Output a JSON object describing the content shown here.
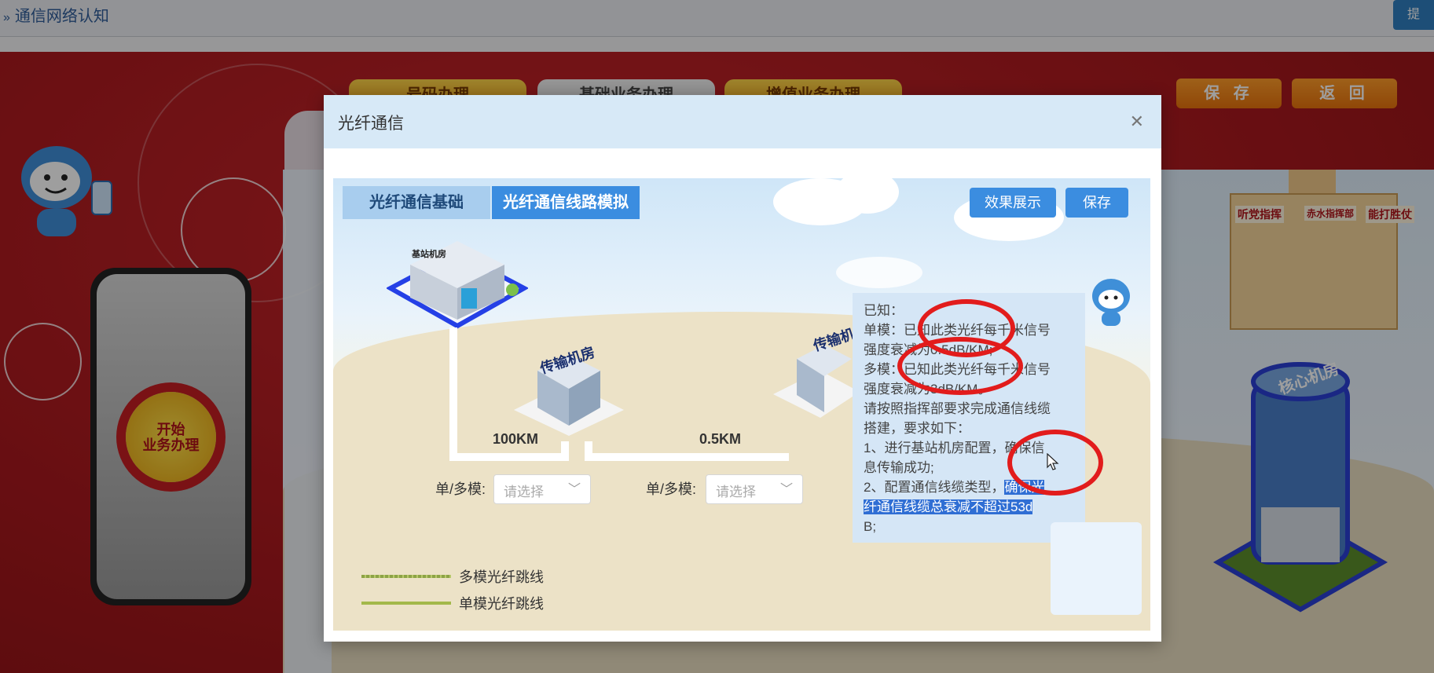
{
  "topbar": {
    "breadcrumb_arrow": "»",
    "breadcrumb": "通信网络认知",
    "right_button": "提"
  },
  "background": {
    "tabs": [
      "号码办理",
      "基础业务办理",
      "增值业务办理"
    ],
    "save_label": "保 存",
    "back_label": "返 回",
    "start_button": "开始\n业务办理",
    "hq_signs": [
      "听党指挥",
      "赤水指挥部",
      "能打胜仗"
    ],
    "tower_label": "核心机房"
  },
  "modal": {
    "title": "光纤通信",
    "close_icon": "close-icon",
    "tabs": [
      {
        "label": "光纤通信基础",
        "active": false
      },
      {
        "label": "光纤通信线路模拟",
        "active": true
      }
    ],
    "effect_button": "效果展示",
    "save_button": "保存",
    "buildings": {
      "base_station": "基站机房",
      "transmission_1": "传输机房",
      "transmission_2": "传输机"
    },
    "distances": [
      "100KM",
      "0.5KM"
    ],
    "selects": [
      {
        "label": "单/多模:",
        "placeholder": "请选择"
      },
      {
        "label": "单/多模:",
        "placeholder": "请选择"
      }
    ],
    "legend": [
      {
        "label": "多模光纤跳线",
        "color": "#8da346"
      },
      {
        "label": "单模光纤跳线",
        "color": "#a3b84a"
      }
    ],
    "info": {
      "l1": "已知：",
      "l2": "单模：已知此类光纤每千米信号",
      "l3": "强度衰减为0.5dB/KM;",
      "l4": "多模：已知此类光纤每千米信号",
      "l5": "强度衰减为3dB/KM。",
      "l6": "请按照指挥部要求完成通信线缆",
      "l7": "搭建，要求如下：",
      "l8": "1、进行基站机房配置，确保信",
      "l9": "息传输成功;",
      "l10a": "2、配置通信线缆类型，",
      "l10b": "确保光",
      "l11": "纤通信线缆总衰减不超过53d",
      "l12": "B;"
    }
  },
  "colors": {
    "accent_blue": "#3b8de0",
    "annotation_red": "#e21c1c",
    "stage_red": "#b3191e"
  }
}
